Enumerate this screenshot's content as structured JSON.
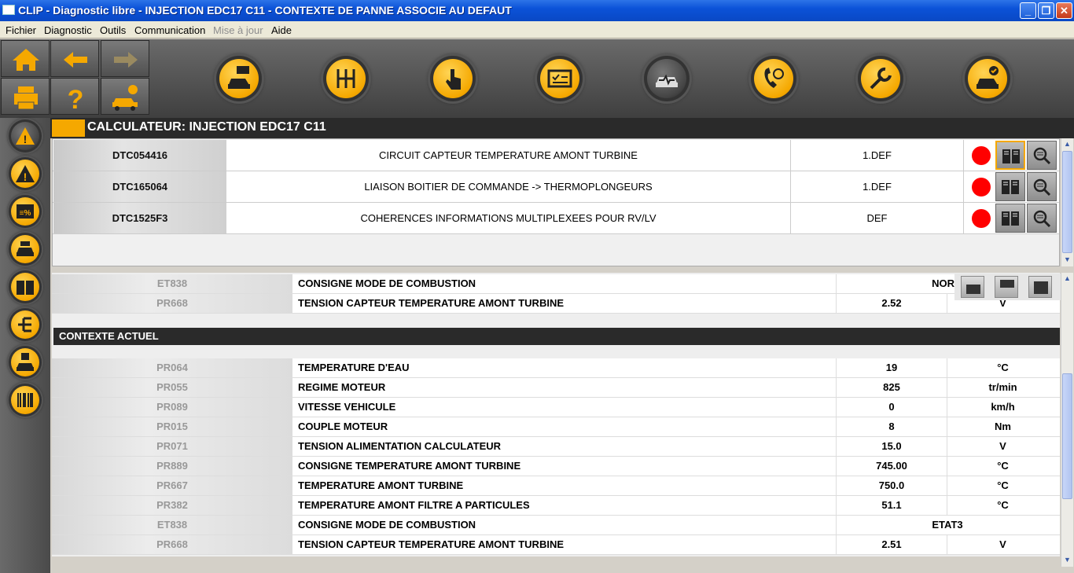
{
  "window": {
    "title": "CLIP - Diagnostic libre - INJECTION EDC17 C11 - CONTEXTE DE PANNE ASSOCIE AU DEFAUT",
    "buttons": [
      "_",
      "❐",
      "✕"
    ]
  },
  "menu": {
    "items": [
      "Fichier",
      "Diagnostic",
      "Outils",
      "Communication",
      "Mise à jour",
      "Aide"
    ]
  },
  "calculator": {
    "header": "CALCULATEUR: INJECTION EDC17 C11"
  },
  "dtcs": [
    {
      "code": "DTC054416",
      "description": "CIRCUIT CAPTEUR TEMPERATURE AMONT TURBINE",
      "status": "1.DEF"
    },
    {
      "code": "DTC165064",
      "description": "LIAISON  BOITIER DE COMMANDE -> THERMOPLONGEURS",
      "status": "1.DEF"
    },
    {
      "code": "DTC1525F3",
      "description": "COHERENCES INFORMATIONS MULTIPLEXEES POUR RV/LV",
      "status": "DEF"
    }
  ],
  "context_prev": [
    {
      "code": "ET838",
      "name": "CONSIGNE MODE DE COMBUSTION",
      "value": "NORM",
      "unit": ""
    },
    {
      "code": "PR668",
      "name": "TENSION CAPTEUR TEMPERATURE AMONT TURBINE",
      "value": "2.52",
      "unit": "V"
    }
  ],
  "current_context": {
    "title": "CONTEXTE ACTUEL",
    "rows": [
      {
        "code": "PR064",
        "name": "TEMPERATURE D'EAU",
        "value": "19",
        "unit": "°C"
      },
      {
        "code": "PR055",
        "name": "REGIME MOTEUR",
        "value": "825",
        "unit": "tr/min"
      },
      {
        "code": "PR089",
        "name": "VITESSE VEHICULE",
        "value": "0",
        "unit": "km/h"
      },
      {
        "code": "PR015",
        "name": "COUPLE MOTEUR",
        "value": "8",
        "unit": "Nm"
      },
      {
        "code": "PR071",
        "name": "TENSION ALIMENTATION CALCULATEUR",
        "value": "15.0",
        "unit": "V"
      },
      {
        "code": "PR889",
        "name": "CONSIGNE TEMPERATURE AMONT TURBINE",
        "value": "745.00",
        "unit": "°C"
      },
      {
        "code": "PR667",
        "name": "TEMPERATURE AMONT TURBINE",
        "value": "750.0",
        "unit": "°C"
      },
      {
        "code": "PR382",
        "name": "TEMPERATURE AMONT FILTRE A PARTICULES",
        "value": "51.1",
        "unit": "°C"
      },
      {
        "code": "ET838",
        "name": "CONSIGNE MODE DE COMBUSTION",
        "value": "ETAT3",
        "unit": ""
      },
      {
        "code": "PR668",
        "name": "TENSION CAPTEUR TEMPERATURE AMONT TURBINE",
        "value": "2.51",
        "unit": "V"
      }
    ]
  }
}
